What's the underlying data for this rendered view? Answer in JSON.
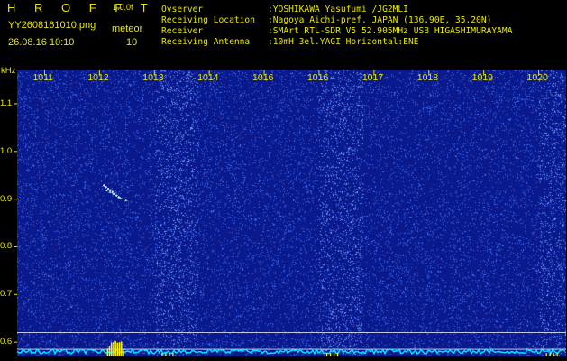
{
  "header": {
    "brand": "H R O F F T",
    "version": "1.0.0f",
    "filename": "YY2608161010.png",
    "label_meteor": "meteor",
    "datetime": "26.08.16 10:10",
    "meteor_count": "10"
  },
  "info": [
    {
      "key": "Ovserver",
      "value": ":YOSHIKAWA Yasufumi /JG2MLI"
    },
    {
      "key": "Receiving Location",
      "value": ":Nagoya Aichi-pref. JAPAN (136.90E, 35.20N)"
    },
    {
      "key": "Receiver",
      "value": ":SMArt RTL-SDR V5 52.905MHz USB HIGASHIMURAYAMA"
    },
    {
      "key": "Receiving Antenna",
      "value": ":10mH 3el.YAGI Horizontal:ENE"
    }
  ],
  "colors": {
    "text": "#e8e800",
    "background_spectrum": "#0a1a8c",
    "noise_dots": "#3a6cff",
    "bright_band": "#7fa8ff",
    "baseline": "#00e5ff",
    "meteor_peak": "#ffee00",
    "grid_line": "#ffffff"
  },
  "chart_data": {
    "type": "heatmap",
    "ylabel": "kHz",
    "y_ticks": [
      "1.1",
      "1.0",
      "0.9",
      "0.8",
      "0.7",
      "0.6"
    ],
    "ylim": [
      0.57,
      1.17
    ],
    "x_ticks": [
      "1011",
      "1012",
      "1013",
      "1014",
      "1016",
      "1016",
      "1017",
      "1018",
      "1019",
      "1020"
    ],
    "xlim": [
      1010.5,
      1020.5
    ],
    "bright_bands_minutes": [
      [
        1013.0,
        1013.8
      ],
      [
        1016.0,
        1016.8
      ],
      [
        1020.0,
        1020.5
      ]
    ],
    "meteor_echo": {
      "minute": 1012.2,
      "khz_start": 0.93,
      "khz_end": 0.9
    },
    "reference_lines_khz": [
      0.62,
      0.585
    ],
    "grid": false
  }
}
